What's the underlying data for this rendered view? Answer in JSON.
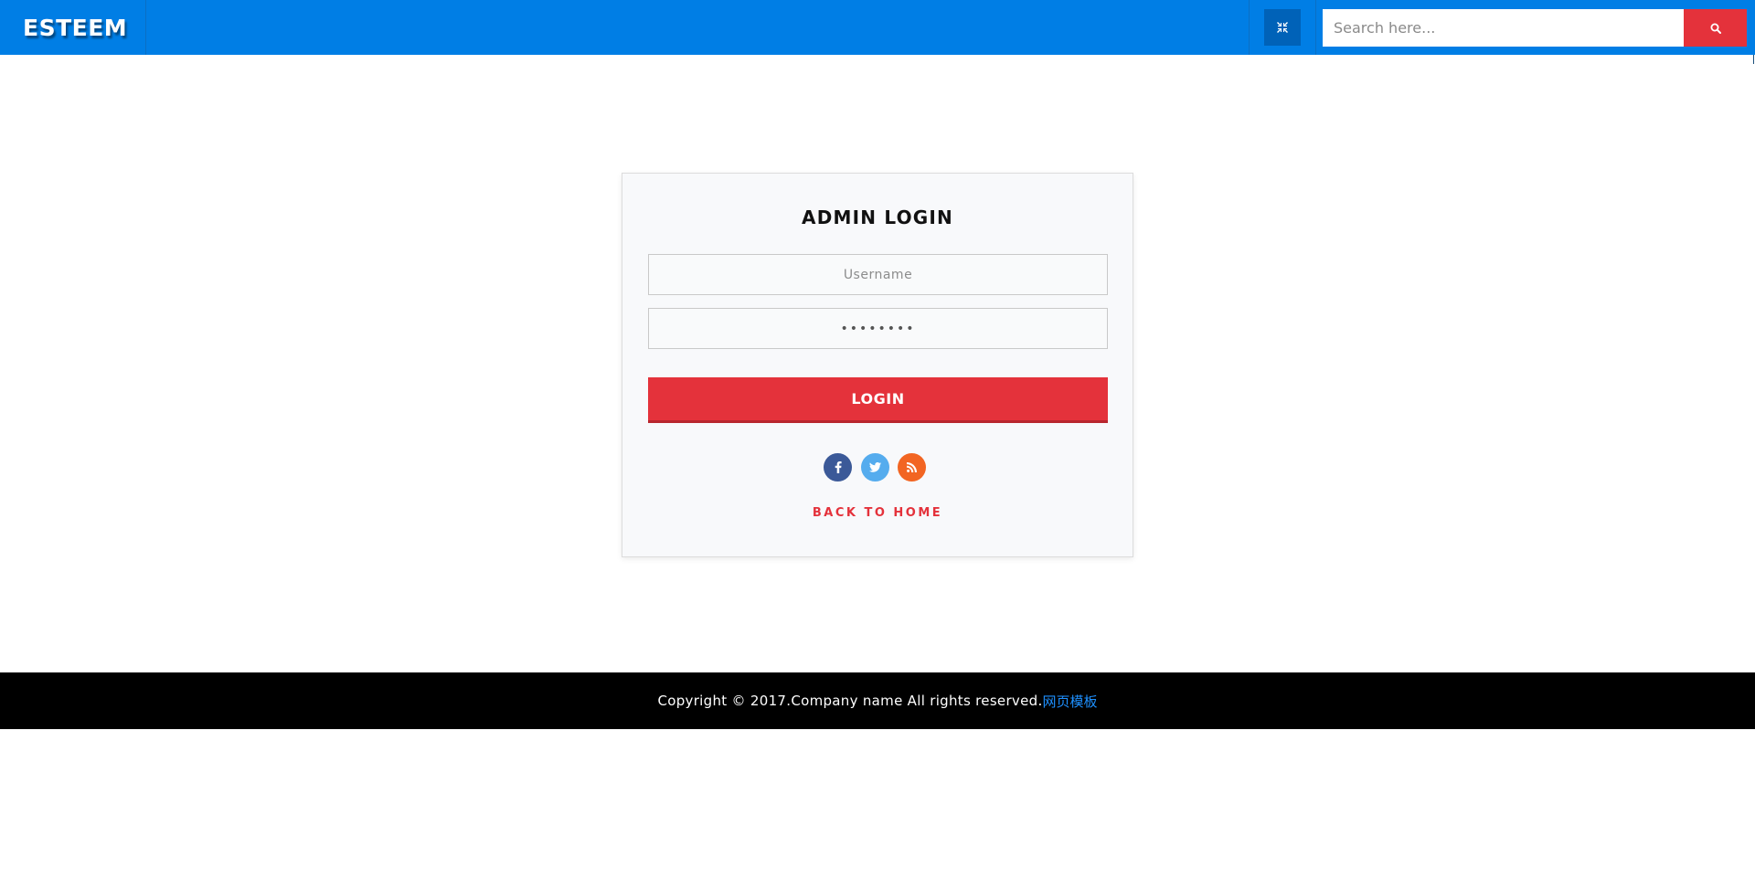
{
  "header": {
    "brand": "ESTEEM",
    "fullscreen_icon": "compress-icon",
    "search": {
      "placeholder": "Search here...",
      "value": "",
      "button_icon": "search-icon"
    }
  },
  "login": {
    "title": "ADMIN LOGIN",
    "username_placeholder": "Username",
    "username_value": "",
    "password_value": "••••••••",
    "submit_label": "LOGIN",
    "social": [
      {
        "name": "facebook-icon",
        "color": "#3b5998"
      },
      {
        "name": "twitter-icon",
        "color": "#55acee"
      },
      {
        "name": "rss-icon",
        "color": "#f26522"
      }
    ],
    "back_link": "BACK TO HOME"
  },
  "footer": {
    "copyright": "Copyright © 2017.Company name All rights reserved.",
    "link_text": "网页模板"
  },
  "colors": {
    "primary": "#007ee5",
    "accent": "#e4323b",
    "footer_bg": "#000000",
    "link": "#1e90ff"
  }
}
